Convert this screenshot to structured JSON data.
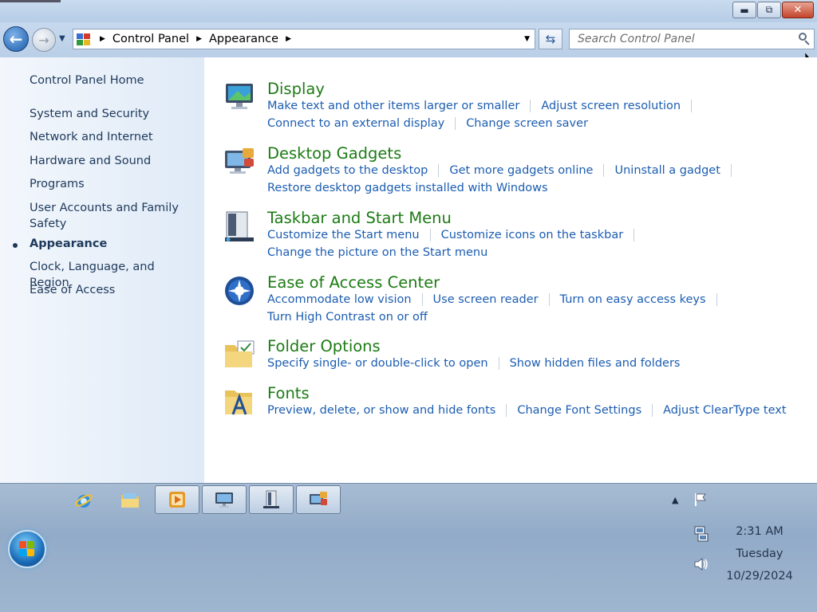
{
  "address_bar": {
    "crumbs": [
      "Control Panel",
      "Appearance"
    ],
    "search_placeholder": "Search Control Panel"
  },
  "left_pane": {
    "home": "Control Panel Home",
    "items": [
      {
        "label": "System and Security"
      },
      {
        "label": "Network and Internet"
      },
      {
        "label": "Hardware and Sound"
      },
      {
        "label": "Programs"
      },
      {
        "label": "User Accounts and Family Safety"
      },
      {
        "label": "Appearance"
      },
      {
        "label": "Clock, Language, and Region"
      },
      {
        "label": "Ease of Access"
      }
    ]
  },
  "categories": [
    {
      "title": "Display",
      "links": [
        [
          "Make text and other items larger or smaller",
          "Adjust screen resolution"
        ],
        [
          "Connect to an external display",
          "Change screen saver"
        ]
      ]
    },
    {
      "title": "Desktop Gadgets",
      "links": [
        [
          "Add gadgets to the desktop",
          "Get more gadgets online",
          "Uninstall a gadget"
        ],
        [
          "Restore desktop gadgets installed with Windows"
        ]
      ]
    },
    {
      "title": "Taskbar and Start Menu",
      "links": [
        [
          "Customize the Start menu",
          "Customize icons on the taskbar"
        ],
        [
          "Change the picture on the Start menu"
        ]
      ]
    },
    {
      "title": "Ease of Access Center",
      "links": [
        [
          "Accommodate low vision",
          "Use screen reader",
          "Turn on easy access keys"
        ],
        [
          "Turn High Contrast on or off"
        ]
      ]
    },
    {
      "title": "Folder Options",
      "links": [
        [
          "Specify single- or double-click to open",
          "Show hidden files and folders"
        ]
      ]
    },
    {
      "title": "Fonts",
      "links": [
        [
          "Preview, delete, or show and hide fonts",
          "Change Font Settings",
          "Adjust ClearType text"
        ]
      ]
    }
  ],
  "taskbar": {
    "quick_launch": [
      "internet-explorer-icon",
      "file-explorer-icon"
    ],
    "open_windows": [
      "media-player-icon",
      "display-control-panel-icon",
      "taskbar-properties-icon",
      "gadgets-icon"
    ],
    "clock": {
      "time": "2:31 AM",
      "day": "Tuesday",
      "date": "10/29/2024"
    }
  },
  "colors": {
    "category_title": "#1d7b15",
    "link": "#1c5db1",
    "nav_text": "#1e395b"
  }
}
